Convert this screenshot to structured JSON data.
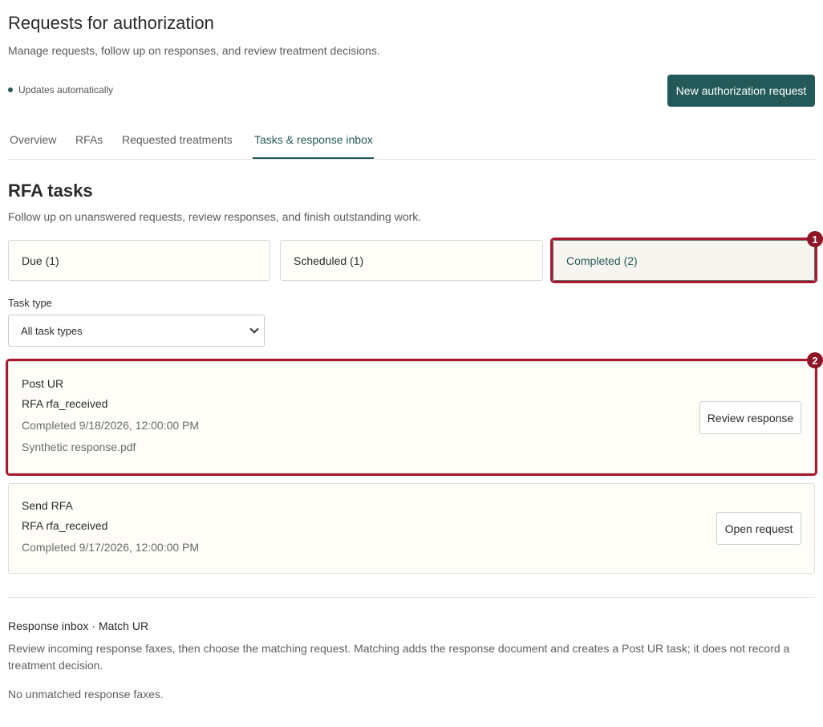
{
  "header": {
    "title": "Requests for authorization",
    "subtitle": "Manage requests, follow up on responses, and review treatment decisions.",
    "status_text": "Updates automatically",
    "new_button_label": "New authorization request"
  },
  "tabs": [
    {
      "label": "Overview",
      "active": false
    },
    {
      "label": "RFAs",
      "active": false
    },
    {
      "label": "Requested treatments",
      "active": false
    },
    {
      "label": "Tasks & response inbox",
      "active": true
    }
  ],
  "rfa_tasks": {
    "title": "RFA tasks",
    "subtitle": "Follow up on unanswered requests, review responses, and finish outstanding work.",
    "filters": [
      {
        "label": "Due (1)",
        "active": false
      },
      {
        "label": "Scheduled (1)",
        "active": false
      },
      {
        "label": "Completed (2)",
        "active": true
      }
    ],
    "task_type_label": "Task type",
    "task_type_value": "All task types",
    "tasks": [
      {
        "name": "Post UR",
        "rfa": "RFA rfa_received",
        "completed": "Completed 9/18/2026, 12:00:00 PM",
        "attachment": "Synthetic response.pdf",
        "action_label": "Review response"
      },
      {
        "name": "Send RFA",
        "rfa": "RFA rfa_received",
        "completed": "Completed 9/17/2026, 12:00:00 PM",
        "action_label": "Open request"
      }
    ]
  },
  "response_inbox": {
    "title": "Response inbox · Match UR",
    "description": "Review incoming response faxes, then choose the matching request. Matching adds the response document and creates a Post UR task; it does not record a treatment decision.",
    "empty_text": "No unmatched response faxes."
  },
  "annotations": {
    "badge_1": "1",
    "badge_2": "2"
  },
  "colors": {
    "accent": "#24595a",
    "highlight": "#a7192f",
    "card_background": "#fffdf8"
  }
}
